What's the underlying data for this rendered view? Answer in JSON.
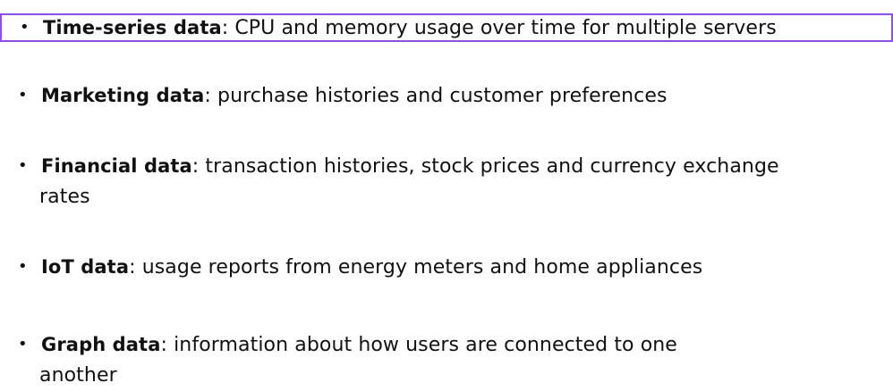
{
  "bullet_glyph": "•",
  "selection_color": "#8e4fe6",
  "items": [
    {
      "term": "Time-series data",
      "separator": ":",
      "text": " CPU and memory usage over time for multiple servers",
      "continuation": ""
    },
    {
      "term": "Marketing data",
      "separator": ":",
      "text": " purchase histories and customer preferences",
      "continuation": ""
    },
    {
      "term": "Financial data",
      "separator": ":",
      "text": " transaction histories, stock prices and currency exchange",
      "continuation": "rates"
    },
    {
      "term": "IoT data",
      "separator": ":",
      "text": " usage reports from energy meters and home appliances",
      "continuation": ""
    },
    {
      "term": "Graph data",
      "separator": ":",
      "text": " information about how users are connected to one",
      "continuation": "another"
    }
  ]
}
